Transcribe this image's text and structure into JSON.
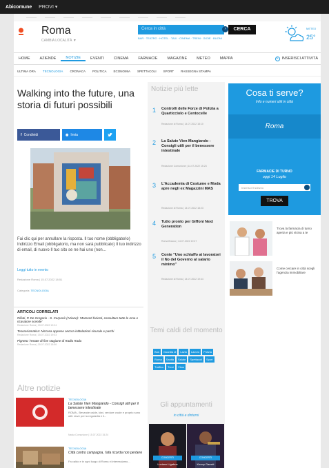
{
  "topbar": {
    "brand_a": "Abi",
    "brand_b": "comune",
    "menu": "PROVI ▾"
  },
  "toplinks": [
    "———",
    "———",
    "———",
    "———",
    "———",
    "———",
    "———",
    "———",
    "———"
  ],
  "header": {
    "city": "Roma",
    "city_sub": "CAMBIA LOCALITÀ ▼",
    "search_placeholder": "Cerca in città",
    "search_button": "CERCA",
    "search_links": "BAR · TEATRO · HOTEL · TAXI · CINEMA · TRENI · GIOIE · BUONI",
    "weather_label": "METEO",
    "temperature": "25°"
  },
  "nav": {
    "primary": [
      "HOME",
      "AZIENDE",
      "NOTIZIE",
      "EVENTI",
      "CINEMA",
      "FARMACIE",
      "MAGAZINE",
      "METEO",
      "MAPPA"
    ],
    "primary_active": 2,
    "insert": "INSERISCI ATTIVITÀ",
    "secondary": [
      "ULTIMA ORA",
      "TECNOLOGIA",
      "CRONACA",
      "POLITICA",
      "ECONOMIA",
      "SPETTACOLI",
      "SPORT",
      "RASSEGNA STAMPA"
    ],
    "secondary_active": 1
  },
  "article": {
    "title": "Walking into the future, una storia di futuri possibili",
    "share_fb": "Condividi",
    "share_msg": "Invia",
    "text": "Fai clic qui per annullare la risposta. Il tuo nome (obbligatorio) Indirizzo Email (obbligatorio, ma non sarà pubblicato) Il tuo indirizzo di email, di nuovo Il tuo sito se ne hai uno (non...",
    "read_more": "Leggi tutto in evento",
    "meta": "Redazione Roma | 15.07.2022 18:51",
    "category_label": "Categoria:",
    "category": "TECNOLOGIA"
  },
  "related": {
    "heading": "ARTICOLI CORRELATI",
    "items": [
      {
        "title": "Rifiuti, P. De Gregorio - S. Carpenè (Azione): 'Momenti foriesti, consultare tutte le Ama e ricavatore scende'",
        "meta": "Redazione Roma | 15.07.2022 19:24"
      },
      {
        "title": "Tesoreriamatica: Niccosa apprese ancora intitolazioni sicurale e parchi",
        "meta": "Redazione Roma | 15.07.2022 19:03"
      },
      {
        "title": "Pigneto: l'estate di fine stagione di Radio Rada",
        "meta": "Redazione Roma | 15.07.2022 18:56"
      }
    ]
  },
  "other_news": {
    "heading": "Altre notizie",
    "items": [
      {
        "category": "TECNOLOGIA",
        "title": "La Salute Vien Mangiando - Consigli utili per il benessere intestinale",
        "desc": "ROMA - Bevande calde, kiwi, verdure crude e proprio sono utili: dove per la regolarità e il...",
        "meta": "Nasta Comunione | 15.07.2022 15:24"
      },
      {
        "category": "TECNOLOGIA",
        "title": "Città contro campagna, l'afa ricorda non perdere",
        "desc": "Fa caldo e in ogni luogo di Roma vi interessiamo...",
        "meta": ""
      }
    ]
  },
  "most_read": {
    "heading": "Notizie più lette",
    "items": [
      {
        "n": "1",
        "title": "Controlli delle Forze di Polizia a Quarticciolo e Centocelle",
        "meta": "Redazione di Roma | 14.07.2022 18:10"
      },
      {
        "n": "2",
        "title": "La Salute Vien Mangiando - Consigli utili per il benessere intestinale",
        "meta": "Redazione Comunione | 14.07.2022 15:24"
      },
      {
        "n": "3",
        "title": "L'Accademia di Costume e Moda apre negli ex Magazzini MAS",
        "meta": "Redazione di Roma | 14.07.2022 18:23"
      },
      {
        "n": "4",
        "title": "Tutto pronto per Giffoni Next Generation",
        "meta": "Roma Bracco | 14.07.2022 19:27"
      },
      {
        "n": "5",
        "title": "Conte \"Uno schiaffo ai lavoratori il No del Governo al salario minimo\"",
        "meta": "Redazione di Roma | 14.07.2022 19:44"
      }
    ]
  },
  "hot_topics": {
    "heading": "Temi caldi del momento",
    "tags": [
      "Bus",
      "Guardia di",
      "Lazio",
      "Lavoro",
      "Polizia",
      "Roma",
      "Sanità",
      "Salute",
      "Spettacoli",
      "Sport",
      "Traffico",
      "Treni",
      "Virus"
    ]
  },
  "events": {
    "heading": "Gli appuntamenti",
    "subheading": "in città e dintorni",
    "items": [
      {
        "button": "CONCERTI",
        "caption": "Luciano Ligabue"
      },
      {
        "button": "CONCERTI",
        "caption": "Kenny Garrett"
      }
    ]
  },
  "cosa": {
    "heading": "Cosa ti serve?",
    "subheading": "Info e numeri utili in città",
    "banner": "Roma",
    "pharmacy_heading": "FARMACIE DI TURNO",
    "pharmacy_date": "oggi 14 Luglio",
    "pharmacy_placeholder": "Inserisci l'indirizzo",
    "find_button": "TROVA"
  },
  "promos": [
    {
      "text": "Trova la farmacia di turno aperta e più vicina a te"
    },
    {
      "text": "Come cercare in città scegli l'agenzia immobiliare"
    }
  ]
}
